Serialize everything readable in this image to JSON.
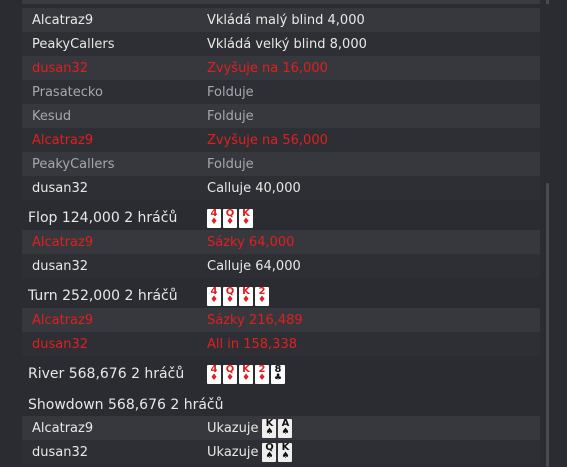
{
  "actions_preflop": [
    {
      "player": "Alcatraz9",
      "action": "Vkládá malý blind 4,000",
      "style": "normal"
    },
    {
      "player": "PeakyCallers",
      "action": "Vkládá velký blind 8,000",
      "style": "normal"
    },
    {
      "player": "dusan32",
      "action": "Zvyšuje na 16,000",
      "style": "red"
    },
    {
      "player": "Prasatecko",
      "action": "Folduje",
      "style": "fold"
    },
    {
      "player": "Kesud",
      "action": "Folduje",
      "style": "fold"
    },
    {
      "player": "Alcatraz9",
      "action": "Zvyšuje na 56,000",
      "style": "red"
    },
    {
      "player": "PeakyCallers",
      "action": "Folduje",
      "style": "fold"
    },
    {
      "player": "dusan32",
      "action": "Calluje 40,000",
      "style": "normal"
    }
  ],
  "streets": {
    "flop": {
      "label": "Flop  124,000  2 hráčů",
      "cards": [
        {
          "rank": "4",
          "suit": "♦",
          "color": "red"
        },
        {
          "rank": "Q",
          "suit": "♦",
          "color": "red"
        },
        {
          "rank": "K",
          "suit": "♦",
          "color": "red"
        }
      ]
    },
    "turn": {
      "label": "Turn  252,000  2 hráčů",
      "cards": [
        {
          "rank": "4",
          "suit": "♦",
          "color": "red"
        },
        {
          "rank": "Q",
          "suit": "♦",
          "color": "red"
        },
        {
          "rank": "K",
          "suit": "♦",
          "color": "red"
        },
        {
          "rank": "2",
          "suit": "♦",
          "color": "red"
        }
      ]
    },
    "river": {
      "label": "River  568,676  2 hráčů",
      "cards": [
        {
          "rank": "4",
          "suit": "♦",
          "color": "red"
        },
        {
          "rank": "Q",
          "suit": "♦",
          "color": "red"
        },
        {
          "rank": "K",
          "suit": "♦",
          "color": "red"
        },
        {
          "rank": "2",
          "suit": "♦",
          "color": "red"
        },
        {
          "rank": "8",
          "suit": "♣",
          "color": "black"
        }
      ]
    },
    "showdown": {
      "label": "Showdown  568,676  2 hráčů"
    }
  },
  "actions_flop": [
    {
      "player": "Alcatraz9",
      "action": "Sázky 64,000",
      "style": "red"
    },
    {
      "player": "dusan32",
      "action": "Calluje 64,000",
      "style": "normal"
    }
  ],
  "actions_turn": [
    {
      "player": "Alcatraz9",
      "action": "Sázky 216,489",
      "style": "red"
    },
    {
      "player": "dusan32",
      "action": "All in 158,338",
      "style": "red"
    }
  ],
  "showdown": [
    {
      "player": "Alcatraz9",
      "action": "Ukazuje",
      "cards": [
        {
          "rank": "K",
          "suit": "♠",
          "color": "black"
        },
        {
          "rank": "A",
          "suit": "♠",
          "color": "black"
        }
      ]
    },
    {
      "player": "dusan32",
      "action": "Ukazuje",
      "cards": [
        {
          "rank": "Q",
          "suit": "♠",
          "color": "black"
        },
        {
          "rank": "K",
          "suit": "♠",
          "color": "black"
        }
      ]
    }
  ],
  "colors": {
    "red": "#e01f1f",
    "normal": "#e8e8e8",
    "fold": "#a8a8ab",
    "background": "#2b2c31"
  }
}
